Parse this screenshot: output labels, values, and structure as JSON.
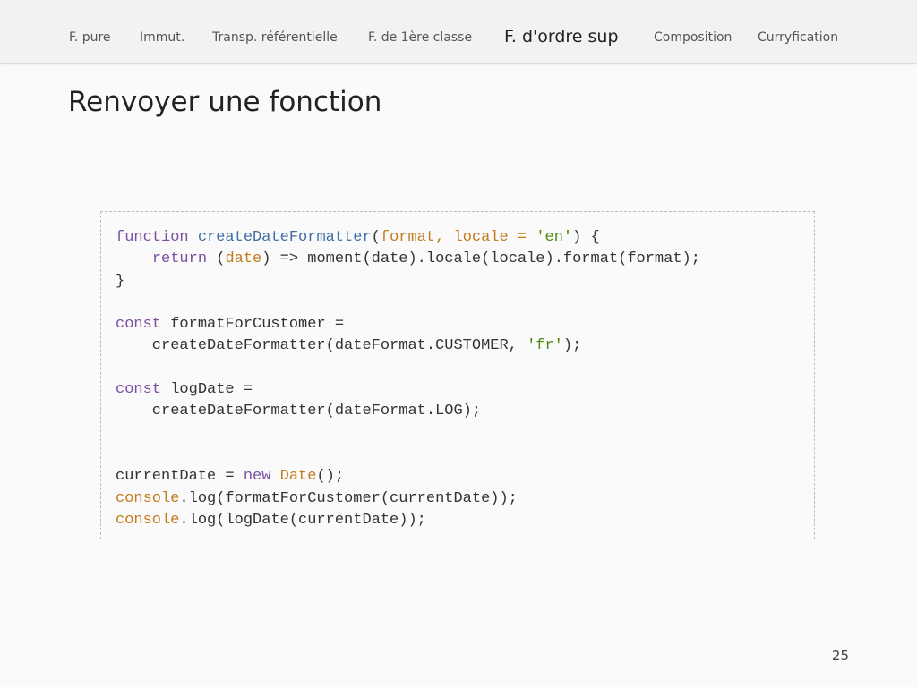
{
  "nav": {
    "items": [
      {
        "label": "F. pure"
      },
      {
        "label": "Immut."
      },
      {
        "label": "Transp. référentielle"
      },
      {
        "label": "F. de 1ère classe"
      },
      {
        "label": "F. d'ordre sup"
      },
      {
        "label": "Composition"
      },
      {
        "label": "Curryfication"
      }
    ],
    "active_label": "F. d'ordre sup"
  },
  "slide": {
    "title": "Renvoyer une fonction",
    "page_number": "25"
  },
  "code": {
    "lines": [
      [
        {
          "t": "kw",
          "v": "function"
        },
        {
          "t": "plain",
          "v": " "
        },
        {
          "t": "fn",
          "v": "createDateFormatter"
        },
        {
          "t": "plain",
          "v": "("
        },
        {
          "t": "param",
          "v": "format, locale = "
        },
        {
          "t": "str",
          "v": "'en'"
        },
        {
          "t": "plain",
          "v": ") {"
        }
      ],
      [
        {
          "t": "plain",
          "v": "    "
        },
        {
          "t": "kw",
          "v": "return"
        },
        {
          "t": "plain",
          "v": " ("
        },
        {
          "t": "param",
          "v": "date"
        },
        {
          "t": "plain",
          "v": ") => moment(date).locale(locale).format(format);"
        }
      ],
      [
        {
          "t": "plain",
          "v": "}"
        }
      ],
      [
        {
          "t": "plain",
          "v": ""
        }
      ],
      [
        {
          "t": "kw",
          "v": "const"
        },
        {
          "t": "plain",
          "v": " formatForCustomer ="
        }
      ],
      [
        {
          "t": "plain",
          "v": "    createDateFormatter(dateFormat.CUSTOMER, "
        },
        {
          "t": "str",
          "v": "'fr'"
        },
        {
          "t": "plain",
          "v": ");"
        }
      ],
      [
        {
          "t": "plain",
          "v": ""
        }
      ],
      [
        {
          "t": "kw",
          "v": "const"
        },
        {
          "t": "plain",
          "v": " logDate ="
        }
      ],
      [
        {
          "t": "plain",
          "v": "    createDateFormatter(dateFormat.LOG);"
        }
      ],
      [
        {
          "t": "plain",
          "v": ""
        }
      ],
      [
        {
          "t": "plain",
          "v": ""
        }
      ],
      [
        {
          "t": "plain",
          "v": "currentDate = "
        },
        {
          "t": "kw",
          "v": "new"
        },
        {
          "t": "plain",
          "v": " "
        },
        {
          "t": "param",
          "v": "Date"
        },
        {
          "t": "plain",
          "v": "();"
        }
      ],
      [
        {
          "t": "param",
          "v": "console"
        },
        {
          "t": "plain",
          "v": ".log(formatForCustomer(currentDate));"
        }
      ],
      [
        {
          "t": "param",
          "v": "console"
        },
        {
          "t": "plain",
          "v": ".log(logDate(currentDate));"
        }
      ]
    ]
  },
  "colors": {
    "keyword": "#7a4fa0",
    "function_name": "#3d6fa6",
    "parameter": "#c27c1c",
    "string": "#4f8a10",
    "text": "#333333"
  }
}
